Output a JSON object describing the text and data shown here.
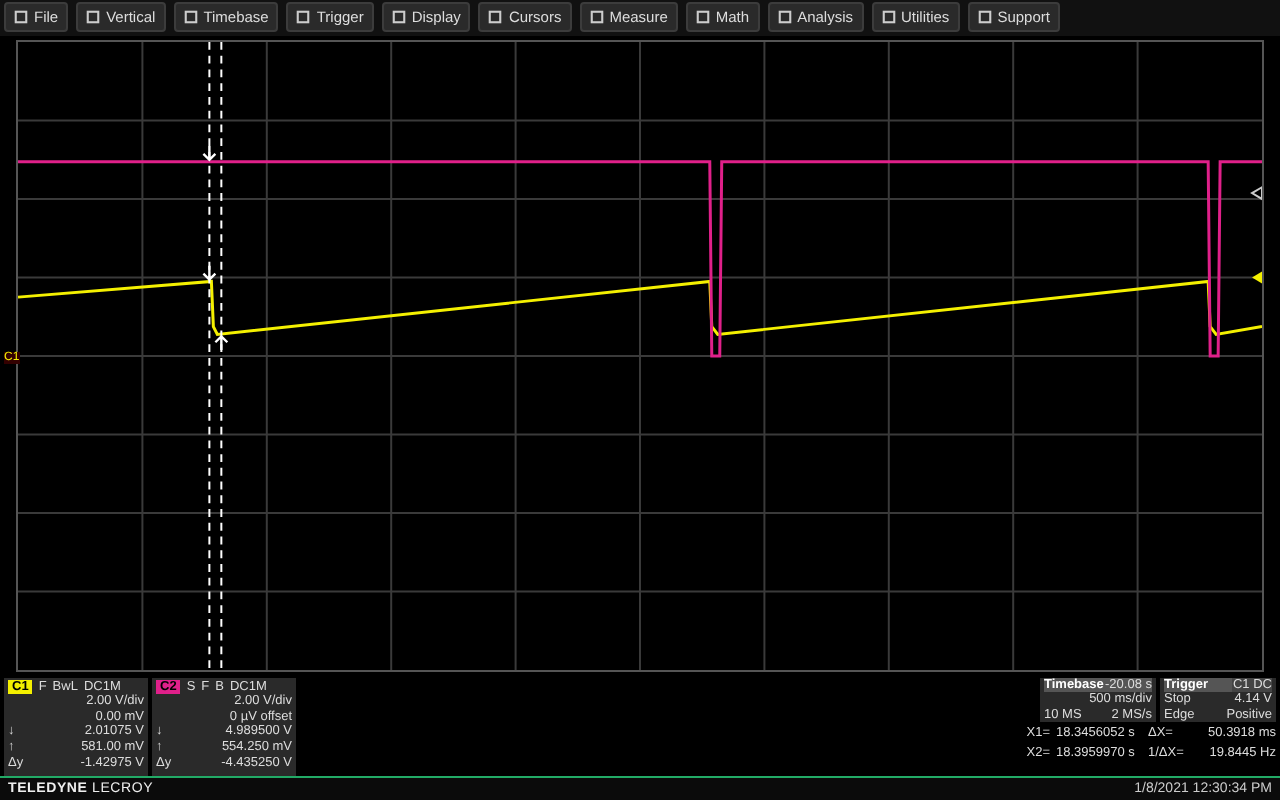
{
  "menu": [
    {
      "label": "File"
    },
    {
      "label": "Vertical"
    },
    {
      "label": "Timebase"
    },
    {
      "label": "Trigger"
    },
    {
      "label": "Display"
    },
    {
      "label": "Cursors"
    },
    {
      "label": "Measure"
    },
    {
      "label": "Math"
    },
    {
      "label": "Analysis"
    },
    {
      "label": "Utilities"
    },
    {
      "label": "Support"
    }
  ],
  "graph": {
    "trace_label": "C1"
  },
  "channels": [
    {
      "badge": "C1",
      "color": "#f4f000",
      "flags": [
        "F",
        "BwL",
        "DC1M"
      ],
      "lines": [
        {
          "value": "2.00 V/div"
        },
        {
          "value": "0.00 mV"
        },
        {
          "sym": "↓",
          "value": "2.01075 V"
        },
        {
          "sym": "↑",
          "value": "581.00 mV"
        },
        {
          "sym": "Δy",
          "value": "-1.42975 V"
        }
      ]
    },
    {
      "badge": "C2",
      "color": "#e0208a",
      "flags": [
        "S",
        "F",
        "B",
        "DC1M"
      ],
      "lines": [
        {
          "value": "2.00 V/div"
        },
        {
          "value": "0 µV offset"
        },
        {
          "sym": "↓",
          "value": "4.989500 V"
        },
        {
          "sym": "↑",
          "value": "554.250 mV"
        },
        {
          "sym": "Δy",
          "value": "-4.435250 V"
        }
      ]
    }
  ],
  "timebase": {
    "title": "Timebase",
    "delay": "-20.08 s",
    "scale": "500 ms/div",
    "samples": "10 MS",
    "rate": "2 MS/s"
  },
  "trigger": {
    "title": "Trigger",
    "source": "C1 DC",
    "mode": "Stop",
    "level": "4.14 V",
    "type": "Edge",
    "slope": "Positive"
  },
  "cursors": [
    {
      "label": "X1=",
      "value": "18.3456052 s",
      "dlabel": "ΔX=",
      "dvalue": "50.3918 ms"
    },
    {
      "label": "X2=",
      "value": "18.3959970 s",
      "dlabel": "1/ΔX=",
      "dvalue": "19.8445 Hz"
    }
  ],
  "footer": {
    "brand": "**TELEDYNE** LECROY",
    "datetime": "1/8/2021 12:30:34 PM"
  }
}
